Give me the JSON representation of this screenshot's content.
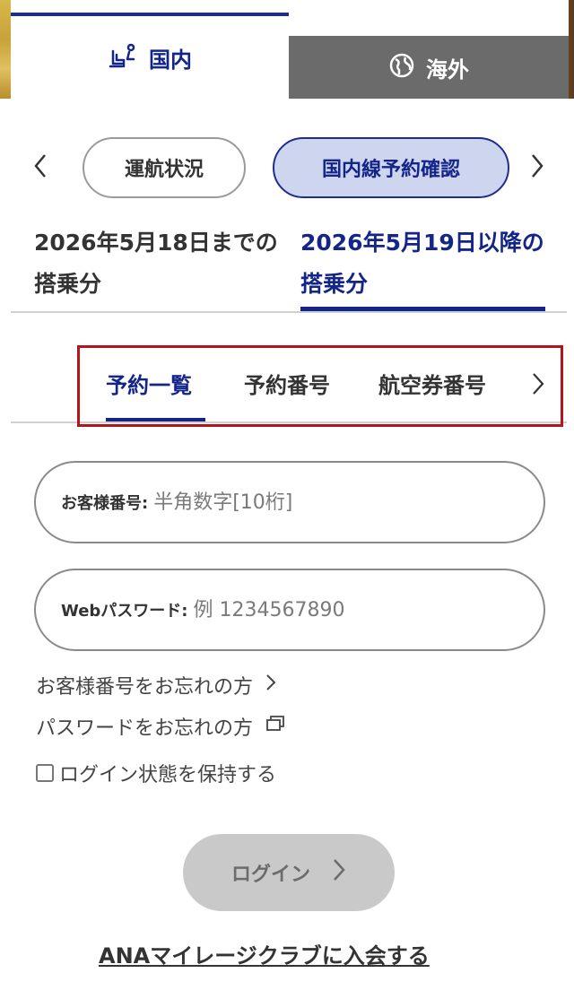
{
  "region_tabs": {
    "domestic": {
      "label": "国内",
      "icon": "seat-icon"
    },
    "international": {
      "label": "海外",
      "icon": "globe-icon"
    }
  },
  "category_nav": {
    "prev_icon": "chevron-left-icon",
    "next_icon": "chevron-right-icon",
    "items": [
      {
        "label": "運航状況",
        "selected": false
      },
      {
        "label": "国内線予約確認",
        "selected": true
      }
    ]
  },
  "date_tabs": [
    {
      "label": "2026年5月18日までの搭乗分",
      "selected": false
    },
    {
      "label": "2026年5月19日以降の搭乗分",
      "selected": true
    }
  ],
  "search_tabs": {
    "items": [
      {
        "label": "予約一覧",
        "selected": true
      },
      {
        "label": "予約番号",
        "selected": false
      },
      {
        "label": "航空券番号",
        "selected": false
      }
    ],
    "next_icon": "chevron-right-icon"
  },
  "form": {
    "customer_number": {
      "label": "お客様番号:",
      "placeholder": "半角数字[10桁]",
      "value": ""
    },
    "web_password": {
      "label": "Webパスワード:",
      "placeholder": "例 1234567890",
      "value": ""
    }
  },
  "links": {
    "forgot_number": "お客様番号をお忘れの方",
    "forgot_password": "パスワードをお忘れの方"
  },
  "remember_login": {
    "label": "ログイン状態を保持する",
    "checked": false
  },
  "login_button": {
    "label": "ログイン",
    "enabled": false
  },
  "join_link": "ANAマイレージクラブに入会する",
  "colors": {
    "brand_navy": "#14258a",
    "selected_pill_bg": "#cdd6ee",
    "highlight_box": "#b3151b",
    "disabled_button": "#c9c9c9"
  }
}
